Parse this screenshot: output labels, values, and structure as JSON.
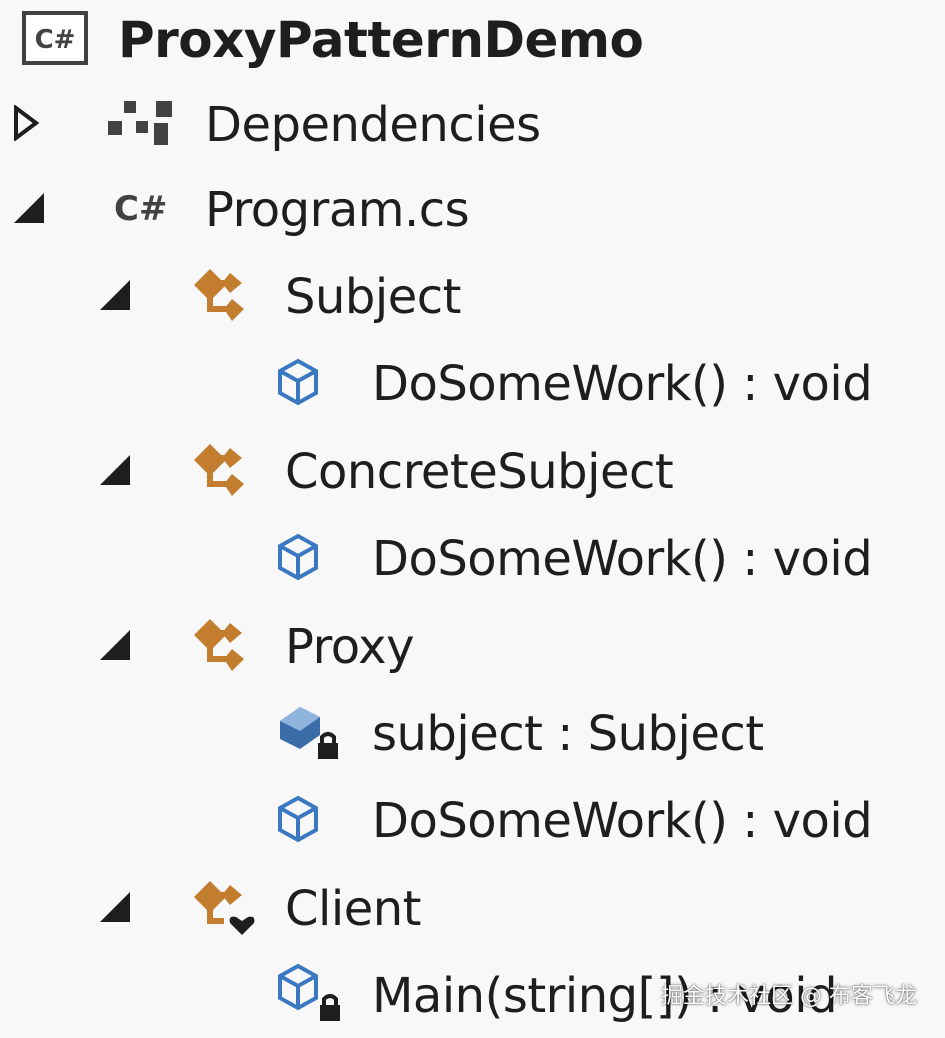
{
  "tree": {
    "project": {
      "label": "ProxyPatternDemo",
      "icon": "csharp-project-icon"
    },
    "dependencies": {
      "label": "Dependencies",
      "icon": "dependencies-icon",
      "expanded": false
    },
    "program": {
      "label": "Program.cs",
      "icon": "csharp-file-icon",
      "expanded": true
    },
    "subject": {
      "label": "Subject",
      "icon": "class-icon",
      "expanded": true
    },
    "subject_method": {
      "label": "DoSomeWork() : void",
      "icon": "method-icon"
    },
    "concrete": {
      "label": "ConcreteSubject",
      "icon": "class-icon",
      "expanded": true
    },
    "concrete_method": {
      "label": "DoSomeWork() : void",
      "icon": "method-icon"
    },
    "proxy": {
      "label": "Proxy",
      "icon": "class-icon",
      "expanded": true
    },
    "proxy_field": {
      "label": "subject : Subject",
      "icon": "private-field-icon"
    },
    "proxy_method": {
      "label": "DoSomeWork() : void",
      "icon": "method-icon"
    },
    "client": {
      "label": "Client",
      "icon": "internal-class-icon",
      "expanded": true
    },
    "client_main": {
      "label": "Main(string[]) : void",
      "icon": "private-method-icon"
    }
  },
  "watermark": "掘金技术社区 @ 布客飞龙",
  "colors": {
    "class_icon": "#c27d2f",
    "method_icon": "#3a78c2",
    "text": "#1e1e1e",
    "background": "#f8f8f9"
  }
}
